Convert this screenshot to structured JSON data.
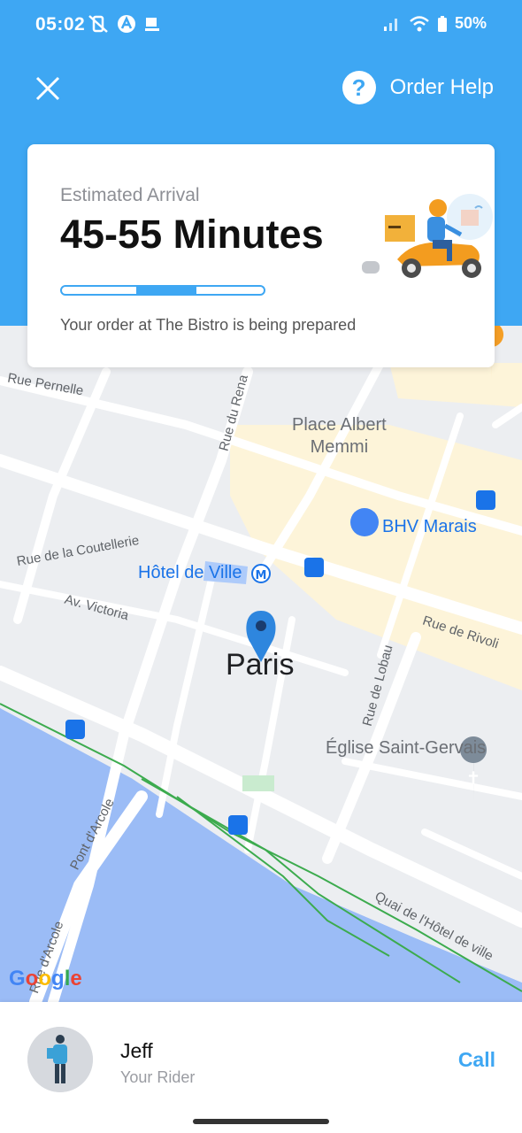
{
  "status_bar": {
    "time": "05:02",
    "battery": "50%"
  },
  "header": {
    "help_label": "Order Help"
  },
  "eta_card": {
    "label": "Estimated Arrival",
    "value": "45-55 Minutes",
    "progress": {
      "segments": 3,
      "active_segment": 2
    },
    "status": "Your order at The Bistro is being prepared"
  },
  "map": {
    "city_label": "Paris",
    "places": {
      "place_albert": "Place Albert\nMemmi",
      "bhv": "BHV Marais",
      "hotel_de_ville": "Hôtel de Ville",
      "eglise": "Église Saint-Gervais"
    },
    "streets": {
      "rue_pernelle": "Rue Pernelle",
      "rue_du_renard": "Rue du Rena",
      "rue_coutellerie": "Rue de la Coutellerie",
      "av_victoria": "Av. Victoria",
      "rue_de_rivoli": "Rue de Rivoli",
      "rue_de_lobau": "Rue de Lobau",
      "pont_darcole": "Pont d'Arcole",
      "quai": "Quai de l'Hôtel de ville",
      "rue_darcole": "Rue d'Arcole"
    },
    "attribution": "Google",
    "colors": {
      "water": "#9bbcf6",
      "land": "#eceef1",
      "commercial": "#fdf4d9",
      "rail": "#3cab4e"
    }
  },
  "rider": {
    "name": "Jeff",
    "role": "Your Rider",
    "call_label": "Call"
  },
  "colors": {
    "accent": "#3ea7f3"
  }
}
